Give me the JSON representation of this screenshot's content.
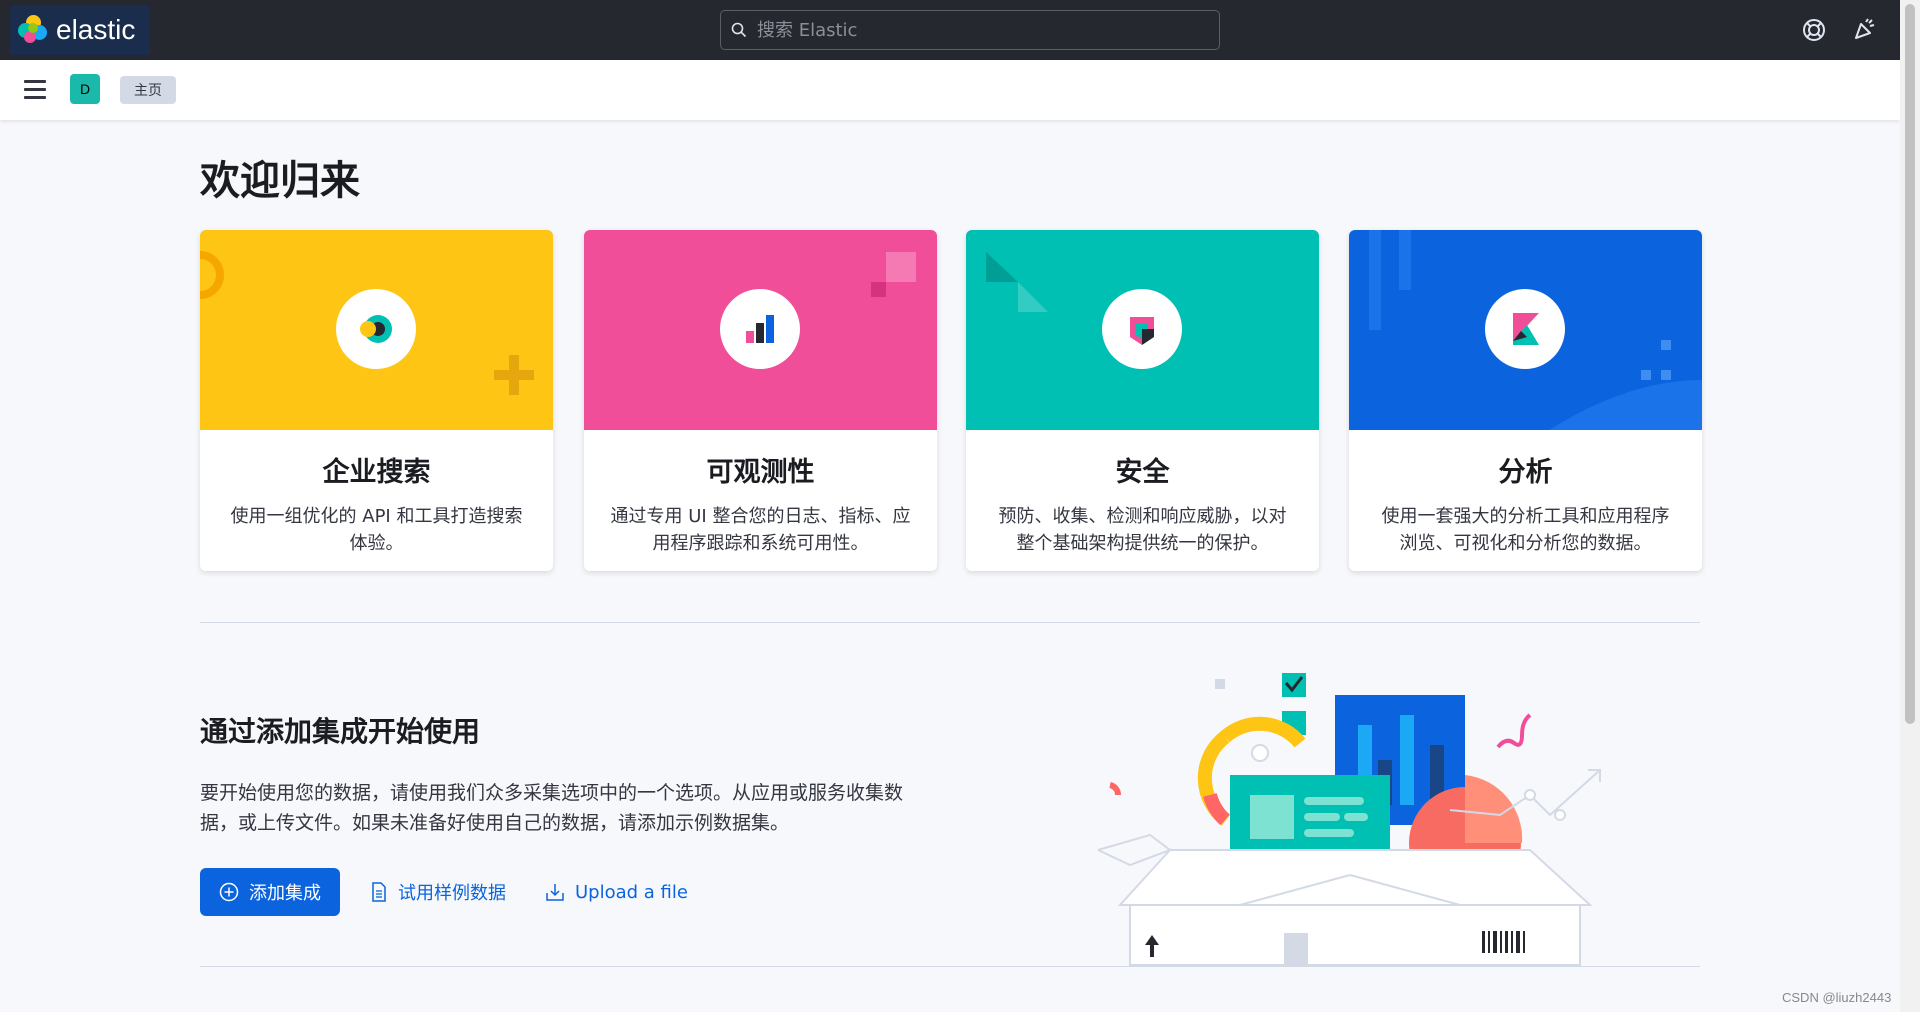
{
  "header": {
    "logo_text": "elastic",
    "search_placeholder": "搜索 Elastic",
    "help_icon": "help-icon",
    "news_icon": "newsfeed-icon"
  },
  "subheader": {
    "space_initial": "D",
    "breadcrumb": "主页"
  },
  "page": {
    "title": "欢迎归来"
  },
  "solutions": [
    {
      "title": "企业搜索",
      "description": "使用一组优化的 API 和工具打造搜索体验。",
      "color": "#fec514",
      "icon": "enterprise-search-icon"
    },
    {
      "title": "可观测性",
      "description": "通过专用 UI 整合您的日志、指标、应用程序跟踪和系统可用性。",
      "color": "#f04e98",
      "icon": "observability-icon"
    },
    {
      "title": "安全",
      "description": "预防、收集、检测和响应威胁，以对整个基础架构提供统一的保护。",
      "color": "#00bfb3",
      "icon": "security-icon"
    },
    {
      "title": "分析",
      "description": "使用一套强大的分析工具和应用程序浏览、可视化和分析您的数据。",
      "color": "#0b64dd",
      "icon": "kibana-icon"
    }
  ],
  "integrations": {
    "title": "通过添加集成开始使用",
    "description": "要开始使用您的数据，请使用我们众多采集选项中的一个选项。从应用或服务收集数据，或上传文件。如果未准备好使用自己的数据，请添加示例数据集。",
    "add_button": "添加集成",
    "sample_link": "试用样例数据",
    "upload_link": "Upload a file"
  },
  "watermark": "CSDN @liuzh2443"
}
